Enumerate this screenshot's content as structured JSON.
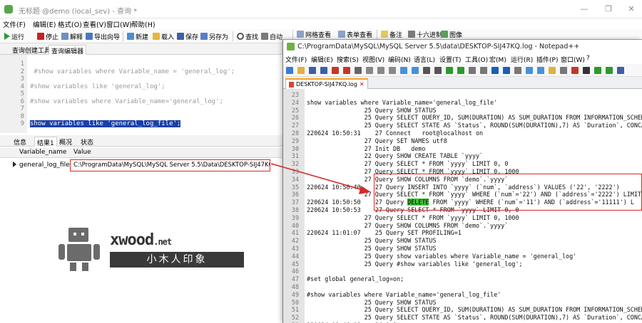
{
  "navicat": {
    "title": "无标题 @demo (local_sev) - 查询 *",
    "window_controls": [
      "—",
      "❐",
      "✕"
    ],
    "menu": [
      "文件(F)",
      "编辑(E)",
      "格式(O)",
      "查看(V)",
      "窗口(W)",
      "帮助(H)"
    ],
    "toolbar": {
      "run": "运行",
      "stop": "停止",
      "explain": "解释",
      "export_wizard": "导出向导",
      "new": "新建",
      "load": "载入",
      "save": "保存",
      "save_as": "另存为",
      "find": "查找",
      "auto_wrap": "自动换行",
      "grid_view": "网格查看",
      "form_view": "表单查看",
      "note": "备注",
      "hex": "十六进制",
      "image": "图像"
    },
    "subtabs": [
      "查询创建工具",
      "查询编辑器"
    ],
    "editor_lines": [
      {
        "n": "1",
        "code": ""
      },
      {
        "n": "2",
        "code": " #show variables where Variable_name = 'general_log';"
      },
      {
        "n": "3",
        "code": ""
      },
      {
        "n": "4",
        "code": "#show variables like 'general_log';"
      },
      {
        "n": "5",
        "code": ""
      },
      {
        "n": "6",
        "code": "#show variables where Variable_name='general_log';"
      },
      {
        "n": "7",
        "code": ""
      },
      {
        "n": "8",
        "code": ""
      },
      {
        "n": "9",
        "code": "show variables like 'general_log_file';"
      }
    ],
    "result_tabs": [
      "信息",
      "结果1",
      "概况",
      "状态"
    ],
    "grid": {
      "columns": [
        "Variable_name",
        "Value"
      ],
      "rows": [
        {
          "name": "general_log_file",
          "value": "C:\\ProgramData\\MySQL\\MySQL Server 5.5\\Data\\DESKTOP-SIJ47KQ.log"
        }
      ]
    }
  },
  "watermark": {
    "brand": "xwood",
    "suffix": ".net",
    "tagline": "小木人印象"
  },
  "notepadpp": {
    "title": "C:\\ProgramData\\MySQL\\MySQL Server 5.5\\data\\DESKTOP-SIJ47KQ.log - Notepad++",
    "menu": [
      "文件(F)",
      "编辑(E)",
      "搜索(S)",
      "视图(V)",
      "编码(N)",
      "语言(L)",
      "设置(T)",
      "工具(O)",
      "宏(M)",
      "运行(R)",
      "插件(P)",
      "窗口(W)",
      "?"
    ],
    "tab": "DESKTOP-SIJ47KQ.log",
    "lines": [
      {
        "n": "23",
        "code": ""
      },
      {
        "n": "24",
        "code": "show variables where Variable_name='general_log_file'"
      },
      {
        "n": "25",
        "code": "                25 Query SHOW STATUS"
      },
      {
        "n": "26",
        "code": "                25 Query SELECT QUERY_ID, SUM(DURATION) AS SUM_DURATION FROM INFORMATION_SCHEMA."
      },
      {
        "n": "27",
        "code": "                25 Query SELECT STATE AS `Status`, ROUND(SUM(DURATION),7) AS `Duration`, CONCAT("
      },
      {
        "n": "28",
        "code": "220624 10:50:31    27 Connect   root@localhost on"
      },
      {
        "n": "29",
        "code": "                27 Query SET NAMES utf8"
      },
      {
        "n": "30",
        "code": "                27 Init DB   demo"
      },
      {
        "n": "31",
        "code": "                22 Query SHOW CREATE TABLE `yyyy`"
      },
      {
        "n": "32",
        "code": "                27 Query SELECT * FROM `yyyy` LIMIT 0, 0"
      },
      {
        "n": "33",
        "code": "                27 Query SELECT * FROM `yyyy` LIMIT 0, 1000"
      },
      {
        "n": "34",
        "code": "                27 Query SHOW COLUMNS FROM `demo`.`yyyy`"
      },
      {
        "n": "35",
        "code": "220624 10:50:40    27 Query INSERT INTO `yyyy` (`num`, `address`) VALUES ('22', '2222')"
      },
      {
        "n": "36",
        "code": "                27 Query SELECT * FROM `yyyy` WHERE (`num`='22') AND (`address`='2222') LIMIT 1"
      },
      {
        "n": "37",
        "pre": "220624 10:50:50    27 Query ",
        "kw": "DELETE",
        "post": " FROM `yyyy` WHERE (`num`='11') AND (`address`='11111') L"
      },
      {
        "n": "38",
        "code": "220624 10:50:53    27 Query SELECT * FROM `yyyy` LIMIT 0, 0"
      },
      {
        "n": "39",
        "code": "                27 Query SELECT * FROM `yyyy` LIMIT 0, 1000"
      },
      {
        "n": "40",
        "code": "                27 Query SHOW COLUMNS FROM `demo`.`yyyy`"
      },
      {
        "n": "41",
        "code": "220624 11:01:07    25 Query SET PROFILING=1"
      },
      {
        "n": "42",
        "code": "                25 Query SHOW STATUS"
      },
      {
        "n": "43",
        "code": "                25 Query SHOW STATUS"
      },
      {
        "n": "44",
        "code": "                25 Query show variables where Variable_name = 'general_log'"
      },
      {
        "n": "45",
        "code": "                25 Query #show variables like 'general_log';"
      },
      {
        "n": "46",
        "code": ""
      },
      {
        "n": "47",
        "code": "#set global general_log=on;"
      },
      {
        "n": "48",
        "code": ""
      },
      {
        "n": "49",
        "code": "#show variables where Variable_name='general_log_file'"
      },
      {
        "n": "50",
        "code": "                25 Query SHOW STATUS"
      },
      {
        "n": "51",
        "code": "                25 Query SELECT QUERY_ID, SUM(DURATION) AS SUM_DURATION FROM INFORMATION_SCHEMA."
      },
      {
        "n": "52",
        "code": "                25 Query SELECT STATE AS `Status`, ROUND(SUM(DURATION),7) AS `Duration`, CONCAT("
      },
      {
        "n": "53",
        "code": "220624 13:46:08    24 Quit"
      }
    ]
  },
  "colors": {
    "selection": "#1a3fa8",
    "annotation_red": "#d42a2a",
    "delete_highlight": "#43c43c",
    "npp_tab_accent": "#f4a11a"
  }
}
